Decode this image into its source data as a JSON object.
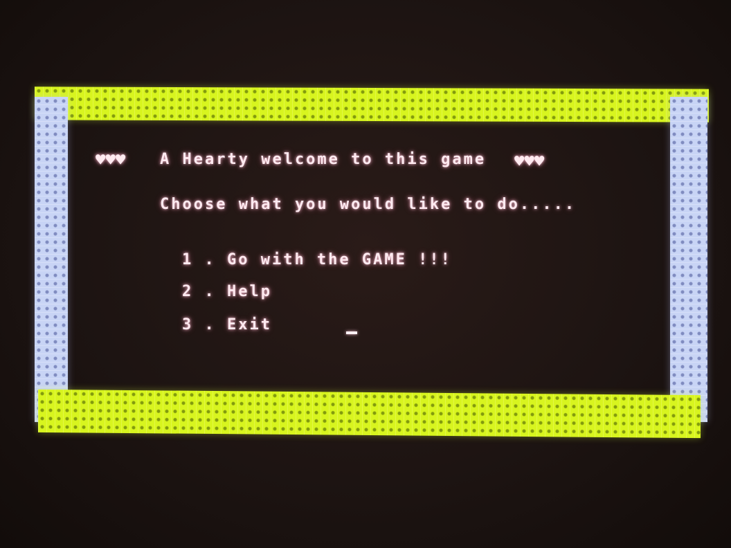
{
  "menu": {
    "hearts_left": "♥♥♥",
    "title": "A Hearty welcome to this game",
    "hearts_right": "♥♥♥",
    "prompt": "Choose what you would like to do.....",
    "options": [
      {
        "label": "1 . Go with the GAME !!!"
      },
      {
        "label": "2 . Help"
      },
      {
        "label": "3 . Exit"
      }
    ]
  },
  "colors": {
    "border_horizontal": "#d8f51f",
    "border_vertical": "#c8d4f5",
    "text": "#ffeaf0",
    "background": "#1d1412"
  }
}
